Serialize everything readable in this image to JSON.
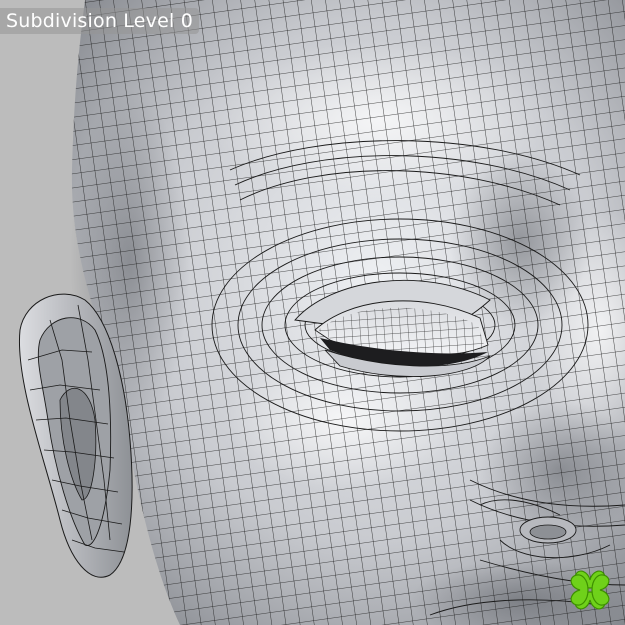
{
  "viewport": {
    "label": "Subdivision Level 0",
    "icons": {
      "head_model": "head-wireframe-model",
      "logo": "four-leaf-clover-logo"
    },
    "colors": {
      "background": "#bcbcbc",
      "surface_light": "#eef0f3",
      "surface_dark": "#7c7f85",
      "wire": "#1a1a1a",
      "logo_green": "#6fd11a"
    }
  }
}
